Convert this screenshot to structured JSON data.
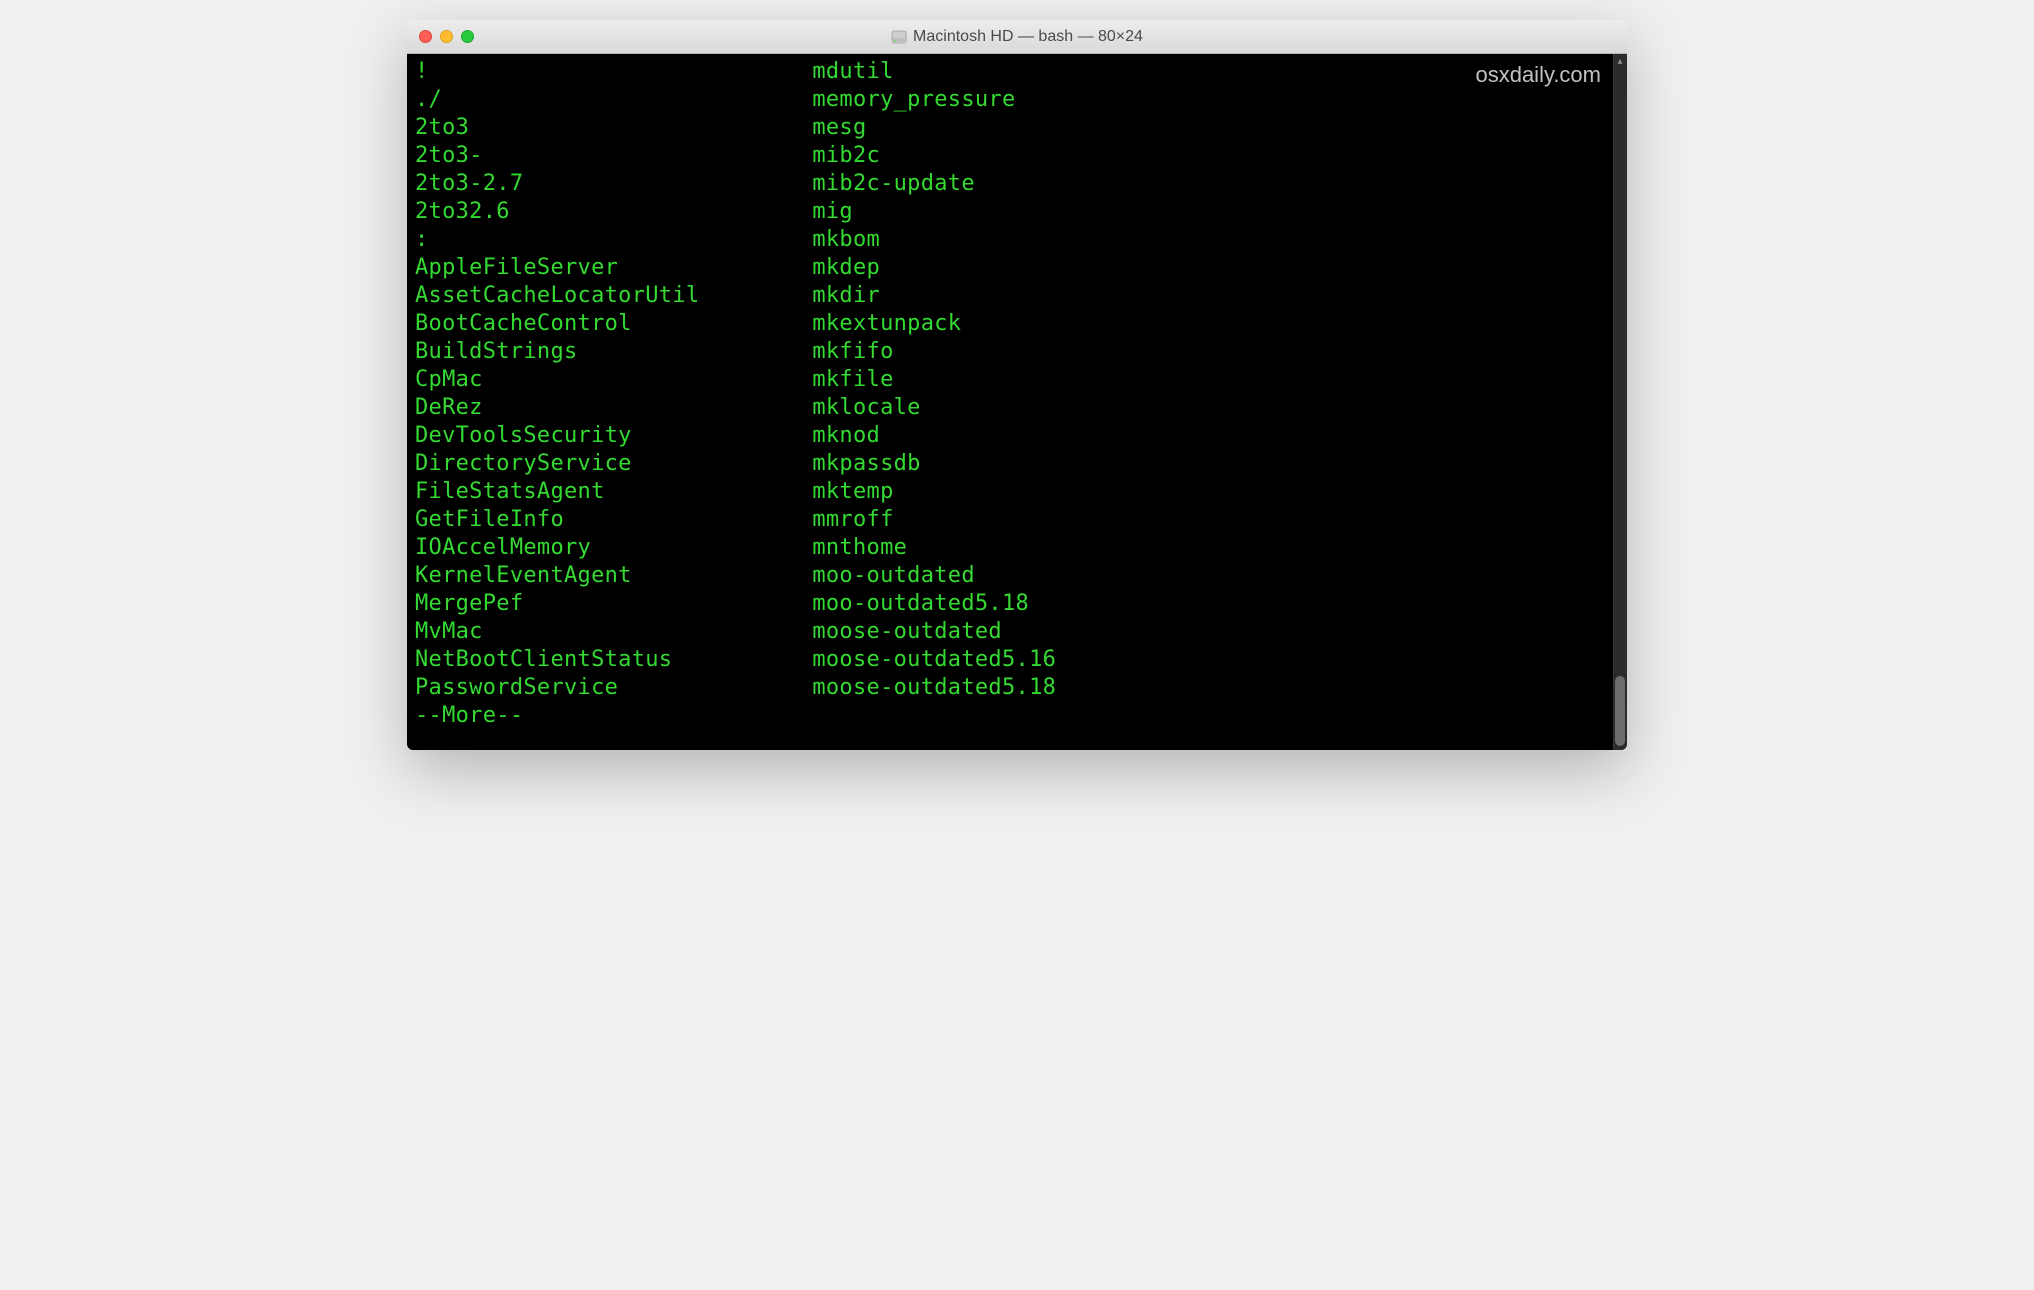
{
  "window": {
    "title": "Macintosh HD — bash — 80×24"
  },
  "watermark": "osxdaily.com",
  "terminal": {
    "rows": [
      {
        "c1": "!",
        "c2": "mdutil"
      },
      {
        "c1": "./",
        "c2": "memory_pressure"
      },
      {
        "c1": "2to3",
        "c2": "mesg"
      },
      {
        "c1": "2to3-",
        "c2": "mib2c"
      },
      {
        "c1": "2to3-2.7",
        "c2": "mib2c-update"
      },
      {
        "c1": "2to32.6",
        "c2": "mig"
      },
      {
        "c1": ":",
        "c2": "mkbom"
      },
      {
        "c1": "AppleFileServer",
        "c2": "mkdep"
      },
      {
        "c1": "AssetCacheLocatorUtil",
        "c2": "mkdir"
      },
      {
        "c1": "BootCacheControl",
        "c2": "mkextunpack"
      },
      {
        "c1": "BuildStrings",
        "c2": "mkfifo"
      },
      {
        "c1": "CpMac",
        "c2": "mkfile"
      },
      {
        "c1": "DeRez",
        "c2": "mklocale"
      },
      {
        "c1": "DevToolsSecurity",
        "c2": "mknod"
      },
      {
        "c1": "DirectoryService",
        "c2": "mkpassdb"
      },
      {
        "c1": "FileStatsAgent",
        "c2": "mktemp"
      },
      {
        "c1": "GetFileInfo",
        "c2": "mmroff"
      },
      {
        "c1": "IOAccelMemory",
        "c2": "mnthome"
      },
      {
        "c1": "KernelEventAgent",
        "c2": "moo-outdated"
      },
      {
        "c1": "MergePef",
        "c2": "moo-outdated5.18"
      },
      {
        "c1": "MvMac",
        "c2": "moose-outdated"
      },
      {
        "c1": "NetBootClientStatus",
        "c2": "moose-outdated5.16"
      },
      {
        "c1": "PasswordService",
        "c2": "moose-outdated5.18"
      }
    ],
    "more_prompt": "--More--"
  }
}
